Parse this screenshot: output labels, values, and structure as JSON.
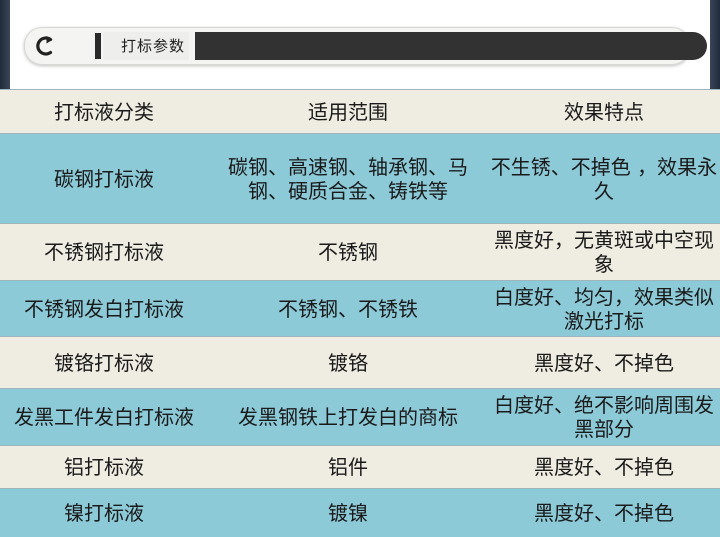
{
  "header": {
    "title": "打标参数",
    "back_icon": "back-arrow-icon"
  },
  "colors": {
    "row_light": "#efece2",
    "row_blue": "#8ccad8",
    "header_dark": "#323232"
  },
  "table": {
    "columns": [
      "打标液分类",
      "适用范围",
      "效果特点"
    ],
    "rows": [
      [
        "碳钢打标液",
        "碳钢、高速钢、轴承钢、马钢、硬质合金、铸铁等",
        "不生锈、不掉色 ，效果永久"
      ],
      [
        "不锈钢打标液",
        "不锈钢",
        "黑度好，无黄斑或中空现象"
      ],
      [
        "不锈钢发白打标液",
        "不锈钢、不锈铁",
        "白度好、均匀，效果类似激光打标"
      ],
      [
        "镀铬打标液",
        "镀铬",
        "黑度好、不掉色"
      ],
      [
        "发黑工件发白打标液",
        "发黑钢铁上打发白的商标",
        "白度好、绝不影响周围发黑部分"
      ],
      [
        "铝打标液",
        "铝件",
        "黑度好、不掉色"
      ],
      [
        "镍打标液",
        "镀镍",
        "黑度好、不掉色"
      ]
    ]
  }
}
